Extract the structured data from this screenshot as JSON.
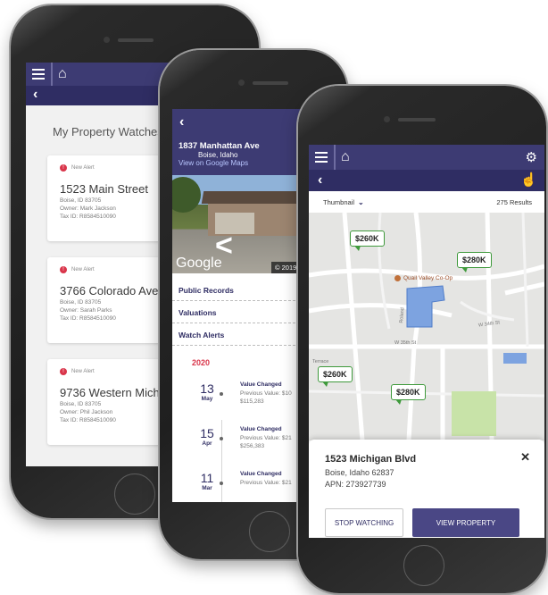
{
  "watches_screen": {
    "title": "My Property Watches",
    "cards": [
      {
        "alert": "New Alert",
        "address": "1523 Main Street",
        "city": "Boise, ID 83705",
        "owner": "Owner: Mark Jackson",
        "tax_id": "Tax ID: R8584510090"
      },
      {
        "alert": "New Alert",
        "address": "3766 Colorado Ave",
        "city": "Boise, ID 83705",
        "owner": "Owner: Sarah Parks",
        "tax_id": "Tax ID: R8584510090"
      },
      {
        "alert": "New Alert",
        "address": "9736 Western Michiga",
        "city": "Boise, ID 83705",
        "owner": "Owner: Phil Jackson",
        "tax_id": "Tax ID: R8584510090"
      }
    ]
  },
  "property_screen": {
    "address": "1837 Manhattan Ave",
    "city": "Boise, Idaho",
    "map_link": "View on Google Maps",
    "photo_google": "Google",
    "photo_credit": "© 2019 Google  |  Terms",
    "sections": [
      "Public Records",
      "Valuations",
      "Watch Alerts"
    ],
    "year": "2020",
    "timeline": [
      {
        "day": "13",
        "month": "May",
        "event": "Value Changed",
        "previous": "Previous Value: $10",
        "value": "$115,283"
      },
      {
        "day": "15",
        "month": "Apr",
        "event": "Value Changed",
        "previous": "Previous Value: $21",
        "value": "$256,383"
      },
      {
        "day": "11",
        "month": "Mar",
        "event": "Value Changed",
        "previous": "Previous Value: $21",
        "value": ""
      }
    ]
  },
  "map_screen": {
    "view_mode": "Thumbnail",
    "results": "275 Results",
    "prices": [
      "$260K",
      "$280K",
      "$260K",
      "$280K"
    ],
    "poi": "Quail Valley Co-Op",
    "streets": [
      "W 34th St",
      "W 35th St",
      "Terrace",
      "Roland"
    ],
    "selected": {
      "address": "1523 Michigan Blvd",
      "city": "Boise, Idaho 62837",
      "apn": "APN: 273927739"
    },
    "stop_label": "STOP WATCHING",
    "view_label": "VIEW PROPERTY"
  },
  "colors": {
    "brand": "#3d3b73",
    "brand_dark": "#2f2d63",
    "alert": "#d9354a",
    "pin_border": "#3f9a3c"
  },
  "icons": [
    "menu-icon",
    "home-icon",
    "back-icon",
    "gear-icon",
    "tap-icon",
    "pin-icon",
    "close-icon",
    "chevron-down-icon"
  ]
}
